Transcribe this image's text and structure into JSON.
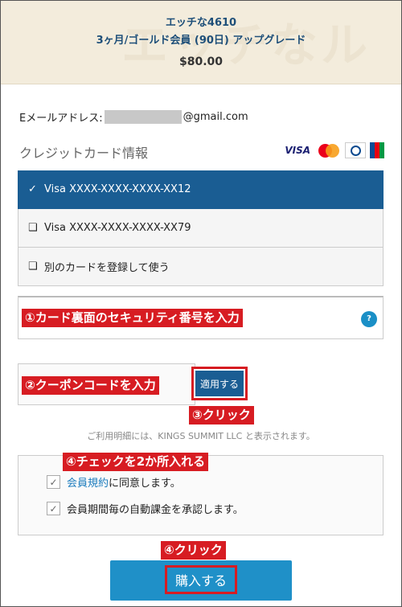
{
  "header": {
    "title_line1": "エッチな4610",
    "title_line2": "3ヶ月/ゴールド会員 (90日) アップグレード",
    "price": "$80.00",
    "watermark": "エッチなル"
  },
  "email": {
    "label": "Eメールアドレス:",
    "domain": "@gmail.com"
  },
  "credit_card": {
    "section_title": "クレジットカード情報",
    "brands": [
      "VISA",
      "MasterCard",
      "Diners Club",
      "JCB"
    ],
    "options": [
      {
        "mark": "✓",
        "label": "Visa XXXX-XXXX-XXXX-XX12",
        "selected": true
      },
      {
        "mark": "❑",
        "label": "Visa XXXX-XXXX-XXXX-XX79",
        "selected": false
      },
      {
        "mark": "❑",
        "label": "別のカードを登録して使う",
        "selected": false
      }
    ]
  },
  "security": {
    "help_icon": "?"
  },
  "coupon": {
    "apply_label": "適用する"
  },
  "billing_note": "ご利用明細には、KINGS SUMMIT LLC と表示されます。",
  "agreements": [
    {
      "link": "会員規約",
      "text": " に同意します。",
      "checked": true
    },
    {
      "link": "",
      "text": "会員期間毎の自動課金を承認します。",
      "checked": true
    }
  ],
  "checkbox_mark": "✓",
  "purchase": {
    "label": "購入する"
  },
  "annotations": {
    "security": "①カード裏面のセキュリティ番号を入力",
    "coupon": "②クーポンコードを入力",
    "click_apply": "③クリック",
    "check_two": "④チェックを2か所入れる",
    "click_buy": "④クリック"
  },
  "colors": {
    "accent_blue": "#1a5d93",
    "button_blue": "#1f90c8",
    "annotation_red": "#d71c22",
    "header_bg": "#f3ecdc"
  }
}
